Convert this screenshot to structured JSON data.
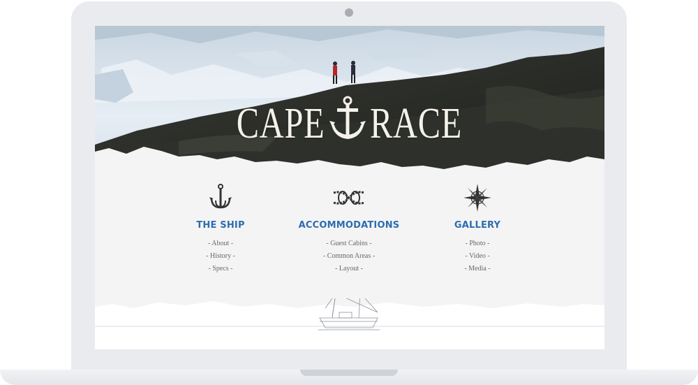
{
  "brand": {
    "word_left": "CAPE",
    "word_right": "RACE",
    "logo_icon": "anchor-icon",
    "text_color": "#f4f1ea"
  },
  "colors": {
    "heading": "#2d6cb0",
    "link": "#666666",
    "background": "#f4f4f5",
    "laptop_frame": "#e9ebef"
  },
  "sections": [
    {
      "title": "THE SHIP",
      "icon": "grappling-hook-icon",
      "links": [
        "- About -",
        "- History -",
        "- Specs -"
      ]
    },
    {
      "title": "ACCOMMODATIONS",
      "icon": "rope-knot-icon",
      "links": [
        "- Guest Cabins -",
        "- Common Areas -",
        "- Layout -"
      ]
    },
    {
      "title": "GALLERY",
      "icon": "compass-rose-icon",
      "links": [
        "- Photo -",
        "- Video -",
        "- Media -"
      ]
    }
  ],
  "footer": {
    "icon": "ship-sketch-icon"
  }
}
